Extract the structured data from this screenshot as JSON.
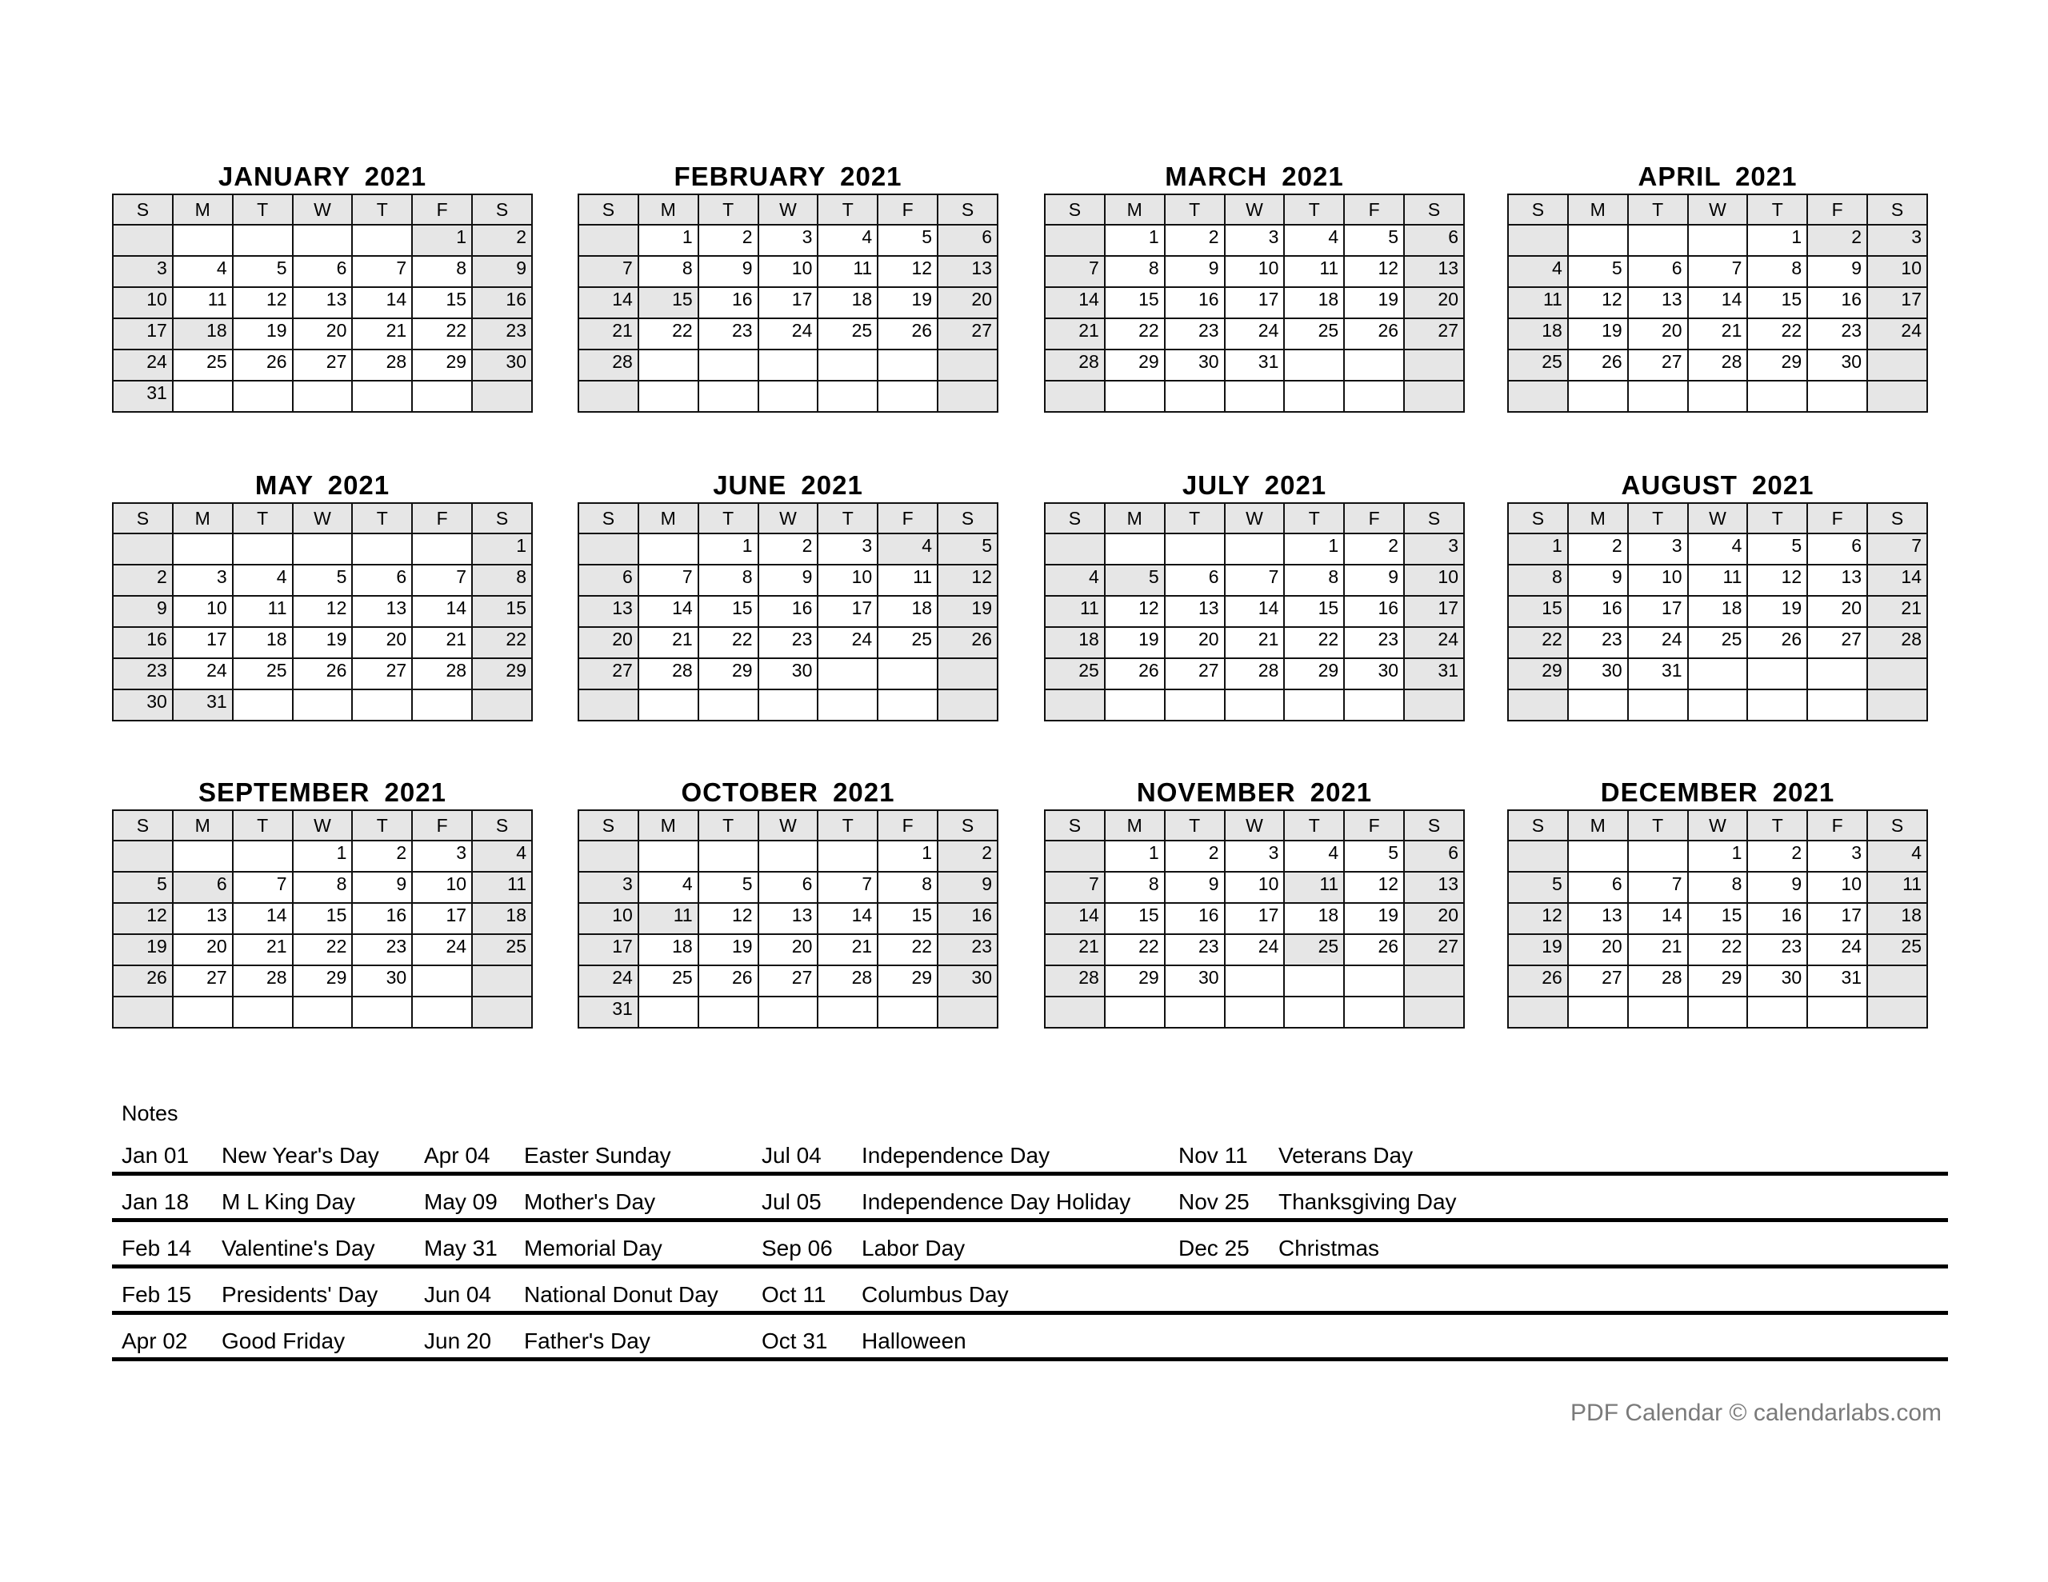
{
  "weekday_headers": [
    "S",
    "M",
    "T",
    "W",
    "T",
    "F",
    "S"
  ],
  "year": 2021,
  "months": [
    {
      "title": "JANUARY  2021",
      "first_weekday": 5,
      "days": 31,
      "shaded_days": [
        1,
        18
      ]
    },
    {
      "title": "FEBRUARY  2021",
      "first_weekday": 1,
      "days": 28,
      "shaded_days": [
        14,
        15
      ]
    },
    {
      "title": "MARCH  2021",
      "first_weekday": 1,
      "days": 31,
      "shaded_days": []
    },
    {
      "title": "APRIL  2021",
      "first_weekday": 4,
      "days": 30,
      "shaded_days": [
        2,
        4
      ]
    },
    {
      "title": "MAY  2021",
      "first_weekday": 6,
      "days": 31,
      "shaded_days": [
        9,
        31
      ]
    },
    {
      "title": "JUNE  2021",
      "first_weekday": 2,
      "days": 30,
      "shaded_days": [
        4,
        20
      ]
    },
    {
      "title": "JULY  2021",
      "first_weekday": 4,
      "days": 31,
      "shaded_days": [
        4,
        5
      ]
    },
    {
      "title": "AUGUST  2021",
      "first_weekday": 0,
      "days": 31,
      "shaded_days": []
    },
    {
      "title": "SEPTEMBER  2021",
      "first_weekday": 3,
      "days": 30,
      "shaded_days": [
        6
      ]
    },
    {
      "title": "OCTOBER  2021",
      "first_weekday": 5,
      "days": 31,
      "shaded_days": [
        11,
        31
      ]
    },
    {
      "title": "NOVEMBER  2021",
      "first_weekday": 1,
      "days": 30,
      "shaded_days": [
        11,
        25
      ]
    },
    {
      "title": "DECEMBER  2021",
      "first_weekday": 3,
      "days": 31,
      "shaded_days": [
        25
      ]
    }
  ],
  "notes": {
    "title": "Notes",
    "rows": [
      [
        {
          "date": "Jan 01",
          "name": "New Year's Day"
        },
        {
          "date": "Apr 04",
          "name": "Easter Sunday"
        },
        {
          "date": "Jul 04",
          "name": "Independence Day"
        },
        {
          "date": "Nov 11",
          "name": "Veterans Day"
        }
      ],
      [
        {
          "date": "Jan 18",
          "name": "M L King Day"
        },
        {
          "date": "May 09",
          "name": "Mother's Day"
        },
        {
          "date": "Jul 05",
          "name": "Independence Day Holiday"
        },
        {
          "date": "Nov 25",
          "name": "Thanksgiving Day"
        }
      ],
      [
        {
          "date": "Feb 14",
          "name": "Valentine's Day"
        },
        {
          "date": "May 31",
          "name": "Memorial Day"
        },
        {
          "date": "Sep 06",
          "name": "Labor Day"
        },
        {
          "date": "Dec 25",
          "name": "Christmas"
        }
      ],
      [
        {
          "date": "Feb 15",
          "name": "Presidents' Day"
        },
        {
          "date": "Jun 04",
          "name": "National Donut Day"
        },
        {
          "date": "Oct 11",
          "name": "Columbus Day"
        },
        {
          "date": "",
          "name": ""
        }
      ],
      [
        {
          "date": "Apr 02",
          "name": "Good Friday"
        },
        {
          "date": "Jun 20",
          "name": "Father's Day"
        },
        {
          "date": "Oct 31",
          "name": "Halloween"
        },
        {
          "date": "",
          "name": ""
        }
      ]
    ]
  },
  "footer": "PDF Calendar © calendarlabs.com",
  "colors": {
    "shade": "#e6e6e6",
    "grid_line": "#111111",
    "footer_text": "#7a7a7a"
  }
}
